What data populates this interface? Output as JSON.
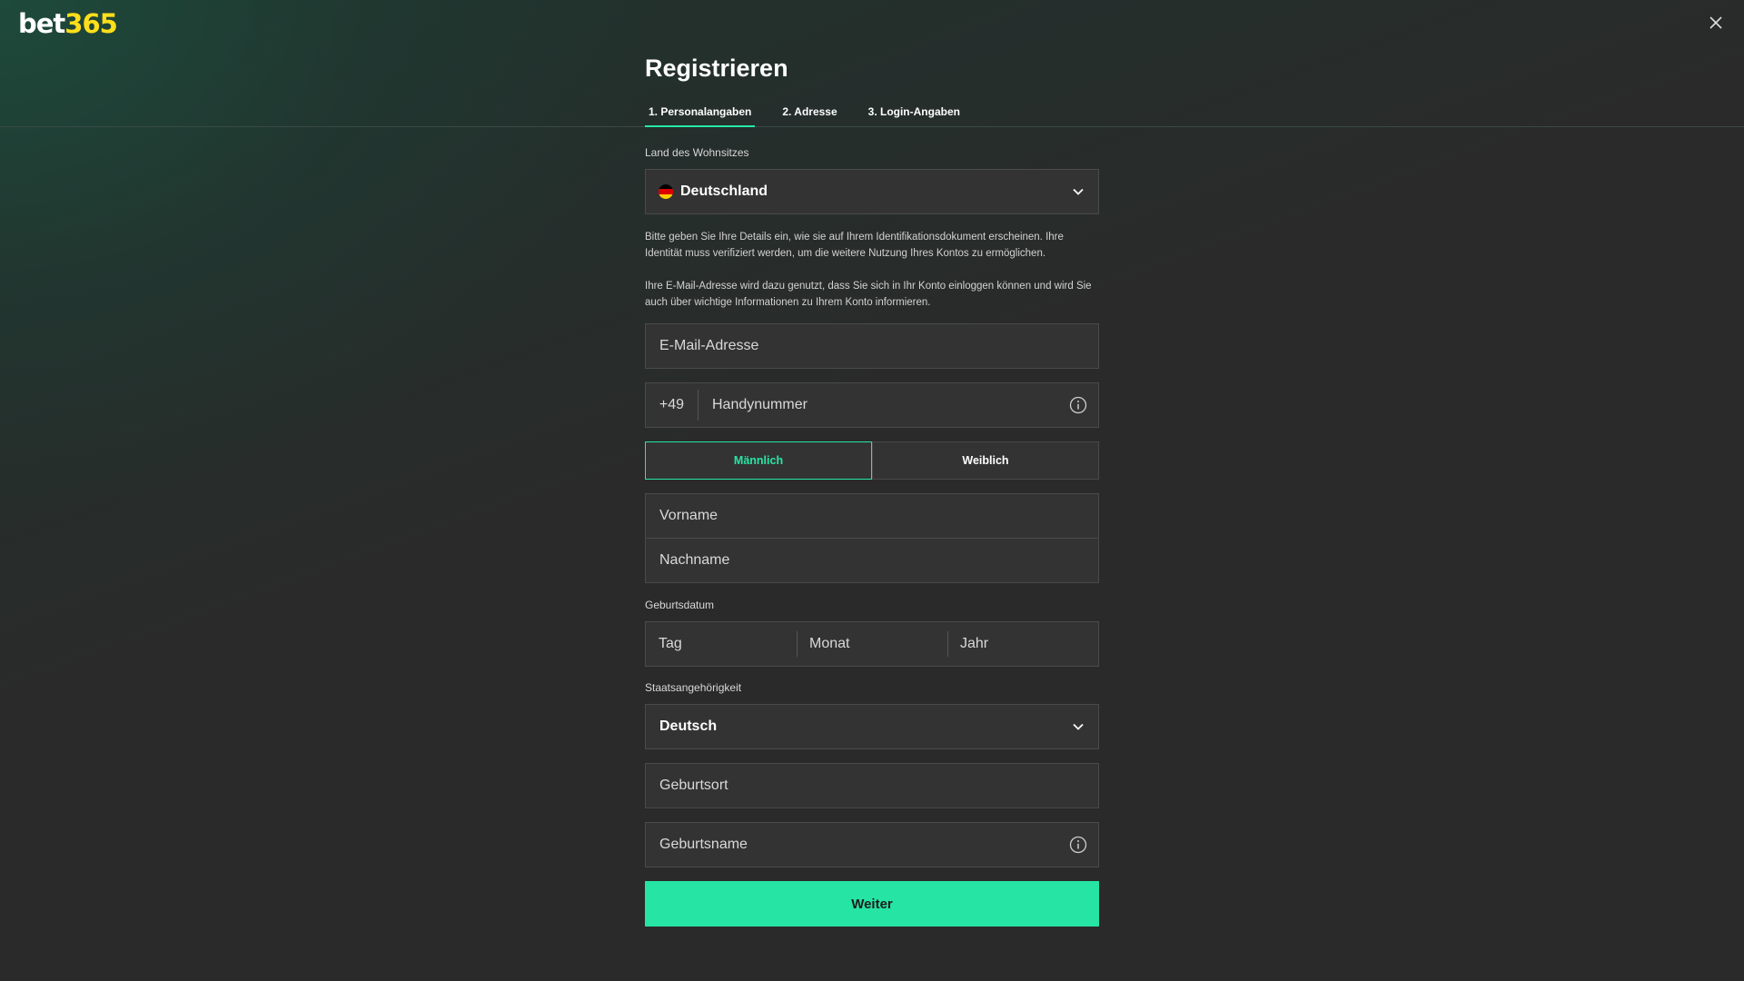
{
  "brand": {
    "name_part1": "bet",
    "name_part2": "365",
    "accent_color": "#ffdf1b"
  },
  "header": {
    "title": "Registrieren"
  },
  "steps": [
    {
      "label": "1.  Personalangaben",
      "active": true
    },
    {
      "label": "2.  Adresse",
      "active": false
    },
    {
      "label": "3.  Login-Angaben",
      "active": false
    }
  ],
  "form": {
    "country": {
      "label": "Land des Wohnsitzes",
      "value": "Deutschland"
    },
    "info_identity": "Bitte geben Sie Ihre Details ein, wie sie auf Ihrem Identifikationsdokument erscheinen. Ihre Identität muss verifiziert werden, um die weitere Nutzung Ihres Kontos zu ermöglichen.",
    "info_email": "Ihre E-Mail-Adresse wird dazu genutzt, dass Sie sich in Ihr Konto einloggen können und wird Sie auch über wichtige Informationen zu Ihrem Konto informieren.",
    "email": {
      "placeholder": "E-Mail-Adresse"
    },
    "phone": {
      "prefix": "+49",
      "placeholder": "Handynummer"
    },
    "gender": {
      "male": "Männlich",
      "female": "Weiblich",
      "selected": "male"
    },
    "first_name": {
      "placeholder": "Vorname"
    },
    "last_name": {
      "placeholder": "Nachname"
    },
    "dob": {
      "label": "Geburtsdatum",
      "day": "Tag",
      "month": "Monat",
      "year": "Jahr"
    },
    "nationality": {
      "label": "Staatsangehörigkeit",
      "value": "Deutsch"
    },
    "birthplace": {
      "placeholder": "Geburtsort"
    },
    "birthname": {
      "placeholder": "Geburtsname"
    },
    "submit_label": "Weiter"
  },
  "colors": {
    "accent": "#26e5a4",
    "background": "#2a2a2a",
    "field_bg": "#333333"
  }
}
